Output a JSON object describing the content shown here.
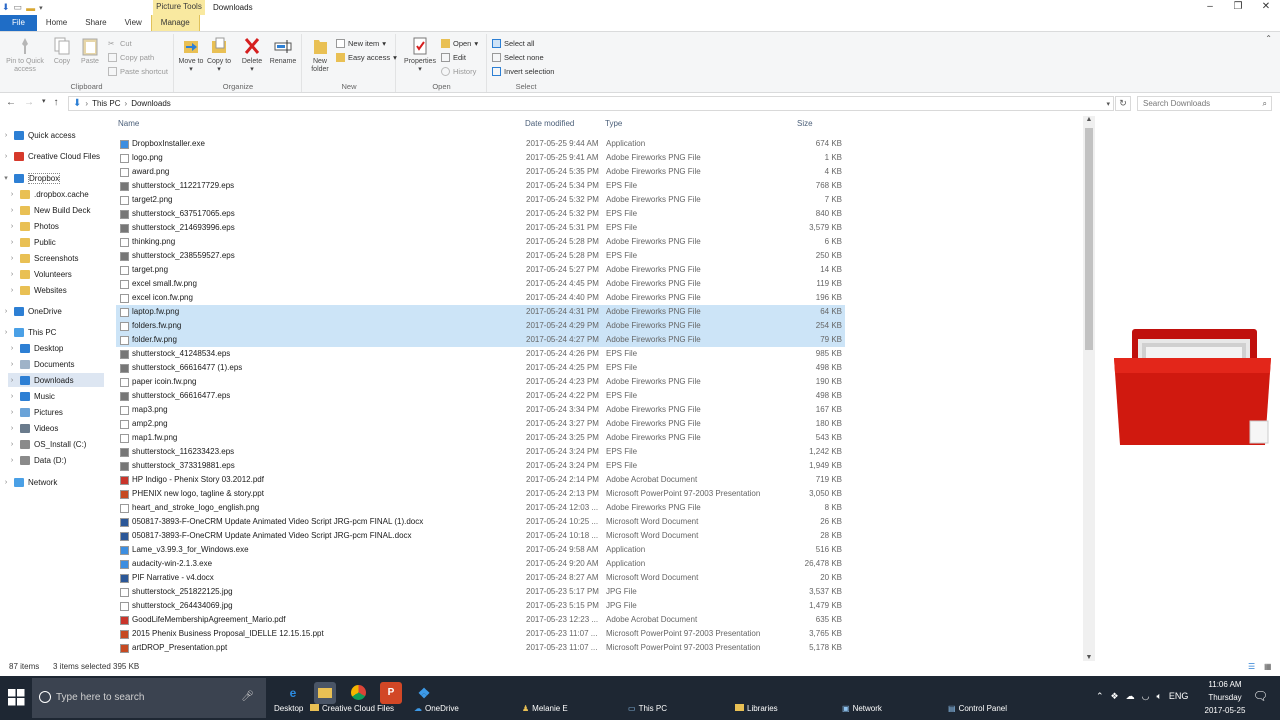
{
  "window": {
    "title": "Downloads",
    "context_tab": "Picture Tools",
    "tabs": [
      "File",
      "Home",
      "Share",
      "View",
      "Manage"
    ]
  },
  "ribbon": {
    "clipboard": {
      "pin": "Pin to Quick access",
      "copy": "Copy",
      "paste": "Paste",
      "cut": "Cut",
      "copy_path": "Copy path",
      "paste_shortcut": "Paste shortcut",
      "label": "Clipboard"
    },
    "organize": {
      "move_to": "Move to",
      "copy_to": "Copy to",
      "delete": "Delete",
      "rename": "Rename",
      "label": "Organize"
    },
    "new": {
      "new_folder": "New folder",
      "new_item": "New item",
      "easy_access": "Easy access",
      "label": "New"
    },
    "open": {
      "properties": "Properties",
      "open": "Open",
      "edit": "Edit",
      "history": "History",
      "label": "Open"
    },
    "select": {
      "select_all": "Select all",
      "select_none": "Select none",
      "invert": "Invert selection",
      "label": "Select"
    }
  },
  "address": {
    "crumbs": [
      "This PC",
      "Downloads"
    ],
    "search_placeholder": "Search Downloads"
  },
  "nav": {
    "items": [
      {
        "label": "Quick access",
        "icon": "star-icon",
        "level": 0
      },
      {
        "label": "Creative Cloud Files",
        "icon": "cloud-icon",
        "level": 0
      },
      {
        "label": "Dropbox",
        "icon": "dropbox-icon",
        "level": 0,
        "selected": true
      },
      {
        "label": ".dropbox.cache",
        "icon": "folder-icon",
        "level": 1
      },
      {
        "label": "New Build Deck",
        "icon": "folder-icon",
        "level": 1
      },
      {
        "label": "Photos",
        "icon": "folder-icon",
        "level": 1
      },
      {
        "label": "Public",
        "icon": "folder-icon",
        "level": 1
      },
      {
        "label": "Screenshots",
        "icon": "folder-icon",
        "level": 1
      },
      {
        "label": "Volunteers",
        "icon": "folder-icon",
        "level": 1
      },
      {
        "label": "Websites",
        "icon": "folder-icon",
        "level": 1
      },
      {
        "label": "OneDrive",
        "icon": "onedrive-icon",
        "level": 0
      },
      {
        "label": "This PC",
        "icon": "pc-icon",
        "level": 0
      },
      {
        "label": "Desktop",
        "icon": "desktop-icon",
        "level": 1
      },
      {
        "label": "Documents",
        "icon": "documents-icon",
        "level": 1
      },
      {
        "label": "Downloads",
        "icon": "download-icon",
        "level": 1,
        "highlight": true
      },
      {
        "label": "Music",
        "icon": "music-icon",
        "level": 1
      },
      {
        "label": "Pictures",
        "icon": "pictures-icon",
        "level": 1
      },
      {
        "label": "Videos",
        "icon": "videos-icon",
        "level": 1
      },
      {
        "label": "OS_Install (C:)",
        "icon": "drive-icon",
        "level": 1
      },
      {
        "label": "Data (D:)",
        "icon": "drive-icon",
        "level": 1
      },
      {
        "label": "Network",
        "icon": "network-icon",
        "level": 0
      }
    ]
  },
  "columns": {
    "name": "Name",
    "date": "Date modified",
    "type": "Type",
    "size": "Size"
  },
  "files": [
    {
      "name": "DropboxInstaller.exe",
      "date": "2017-05-25 9:44 AM",
      "type": "Application",
      "size": "674 KB"
    },
    {
      "name": "logo.png",
      "date": "2017-05-25 9:41 AM",
      "type": "Adobe Fireworks PNG File",
      "size": "1 KB"
    },
    {
      "name": "award.png",
      "date": "2017-05-24 5:35 PM",
      "type": "Adobe Fireworks PNG File",
      "size": "4 KB"
    },
    {
      "name": "shutterstock_112217729.eps",
      "date": "2017-05-24 5:34 PM",
      "type": "EPS File",
      "size": "768 KB"
    },
    {
      "name": "target2.png",
      "date": "2017-05-24 5:32 PM",
      "type": "Adobe Fireworks PNG File",
      "size": "7 KB"
    },
    {
      "name": "shutterstock_637517065.eps",
      "date": "2017-05-24 5:32 PM",
      "type": "EPS File",
      "size": "840 KB"
    },
    {
      "name": "shutterstock_214693996.eps",
      "date": "2017-05-24 5:31 PM",
      "type": "EPS File",
      "size": "3,579 KB"
    },
    {
      "name": "thinking.png",
      "date": "2017-05-24 5:28 PM",
      "type": "Adobe Fireworks PNG File",
      "size": "6 KB"
    },
    {
      "name": "shutterstock_238559527.eps",
      "date": "2017-05-24 5:28 PM",
      "type": "EPS File",
      "size": "250 KB"
    },
    {
      "name": "target.png",
      "date": "2017-05-24 5:27 PM",
      "type": "Adobe Fireworks PNG File",
      "size": "14 KB"
    },
    {
      "name": "excel small.fw.png",
      "date": "2017-05-24 4:45 PM",
      "type": "Adobe Fireworks PNG File",
      "size": "119 KB"
    },
    {
      "name": "excel icon.fw.png",
      "date": "2017-05-24 4:40 PM",
      "type": "Adobe Fireworks PNG File",
      "size": "196 KB"
    },
    {
      "name": "laptop.fw.png",
      "date": "2017-05-24 4:31 PM",
      "type": "Adobe Fireworks PNG File",
      "size": "64 KB",
      "selected": true
    },
    {
      "name": "folders.fw.png",
      "date": "2017-05-24 4:29 PM",
      "type": "Adobe Fireworks PNG File",
      "size": "254 KB",
      "selected": true
    },
    {
      "name": "folder.fw.png",
      "date": "2017-05-24 4:27 PM",
      "type": "Adobe Fireworks PNG File",
      "size": "79 KB",
      "selected": true
    },
    {
      "name": "shutterstock_41248534.eps",
      "date": "2017-05-24 4:26 PM",
      "type": "EPS File",
      "size": "985 KB"
    },
    {
      "name": "shutterstock_66616477 (1).eps",
      "date": "2017-05-24 4:25 PM",
      "type": "EPS File",
      "size": "498 KB"
    },
    {
      "name": "paper icoin.fw.png",
      "date": "2017-05-24 4:23 PM",
      "type": "Adobe Fireworks PNG File",
      "size": "190 KB"
    },
    {
      "name": "shutterstock_66616477.eps",
      "date": "2017-05-24 4:22 PM",
      "type": "EPS File",
      "size": "498 KB"
    },
    {
      "name": "map3.png",
      "date": "2017-05-24 3:34 PM",
      "type": "Adobe Fireworks PNG File",
      "size": "167 KB"
    },
    {
      "name": "amp2.png",
      "date": "2017-05-24 3:27 PM",
      "type": "Adobe Fireworks PNG File",
      "size": "180 KB"
    },
    {
      "name": "map1.fw.png",
      "date": "2017-05-24 3:25 PM",
      "type": "Adobe Fireworks PNG File",
      "size": "543 KB"
    },
    {
      "name": "shutterstock_116233423.eps",
      "date": "2017-05-24 3:24 PM",
      "type": "EPS File",
      "size": "1,242 KB"
    },
    {
      "name": "shutterstock_373319881.eps",
      "date": "2017-05-24 3:24 PM",
      "type": "EPS File",
      "size": "1,949 KB"
    },
    {
      "name": "HP Indigo - Phenix Story 03.2012.pdf",
      "date": "2017-05-24 2:14 PM",
      "type": "Adobe Acrobat Document",
      "size": "719 KB"
    },
    {
      "name": "PHENIX new logo, tagline & story.ppt",
      "date": "2017-05-24 2:13 PM",
      "type": "Microsoft PowerPoint 97-2003 Presentation",
      "size": "3,050 KB"
    },
    {
      "name": "heart_and_stroke_logo_english.png",
      "date": "2017-05-24 12:03 ...",
      "type": "Adobe Fireworks PNG File",
      "size": "8 KB"
    },
    {
      "name": "050817-3893-F-OneCRM Update Animated Video Script JRG-pcm FINAL (1).docx",
      "date": "2017-05-24 10:25 ...",
      "type": "Microsoft Word Document",
      "size": "26 KB"
    },
    {
      "name": "050817-3893-F-OneCRM Update Animated Video Script JRG-pcm FINAL.docx",
      "date": "2017-05-24 10:18 ...",
      "type": "Microsoft Word Document",
      "size": "28 KB"
    },
    {
      "name": "Lame_v3.99.3_for_Windows.exe",
      "date": "2017-05-24 9:58 AM",
      "type": "Application",
      "size": "516 KB"
    },
    {
      "name": "audacity-win-2.1.3.exe",
      "date": "2017-05-24 9:20 AM",
      "type": "Application",
      "size": "26,478 KB"
    },
    {
      "name": "PIF Narrative - v4.docx",
      "date": "2017-05-24 8:27 AM",
      "type": "Microsoft Word Document",
      "size": "20 KB"
    },
    {
      "name": "shutterstock_251822125.jpg",
      "date": "2017-05-23 5:17 PM",
      "type": "JPG File",
      "size": "3,537 KB"
    },
    {
      "name": "shutterstock_264434069.jpg",
      "date": "2017-05-23 5:15 PM",
      "type": "JPG File",
      "size": "1,479 KB"
    },
    {
      "name": "GoodLifeMembershipAgreement_Mario.pdf",
      "date": "2017-05-23 12:23 ...",
      "type": "Adobe Acrobat Document",
      "size": "635 KB"
    },
    {
      "name": "2015 Phenix Business Proposal_IDELLE 12.15.15.ppt",
      "date": "2017-05-23 11:07 ...",
      "type": "Microsoft PowerPoint 97-2003 Presentation",
      "size": "3,765 KB"
    },
    {
      "name": "artDROP_Presentation.ppt",
      "date": "2017-05-23 11:07 ...",
      "type": "Microsoft PowerPoint 97-2003 Presentation",
      "size": "5,178 KB"
    }
  ],
  "status": {
    "count": "87 items",
    "selected": "3 items selected",
    "size": "395 KB"
  },
  "taskbar": {
    "search_placeholder": "Type here to search",
    "items": [
      "Desktop",
      "Creative Cloud Files",
      "OneDrive",
      "Melanie E",
      "This PC",
      "Libraries",
      "Network",
      "Control Panel"
    ],
    "lang": "ENG",
    "time": "11:06 AM",
    "day": "Thursday",
    "date": "2017-05-25"
  }
}
